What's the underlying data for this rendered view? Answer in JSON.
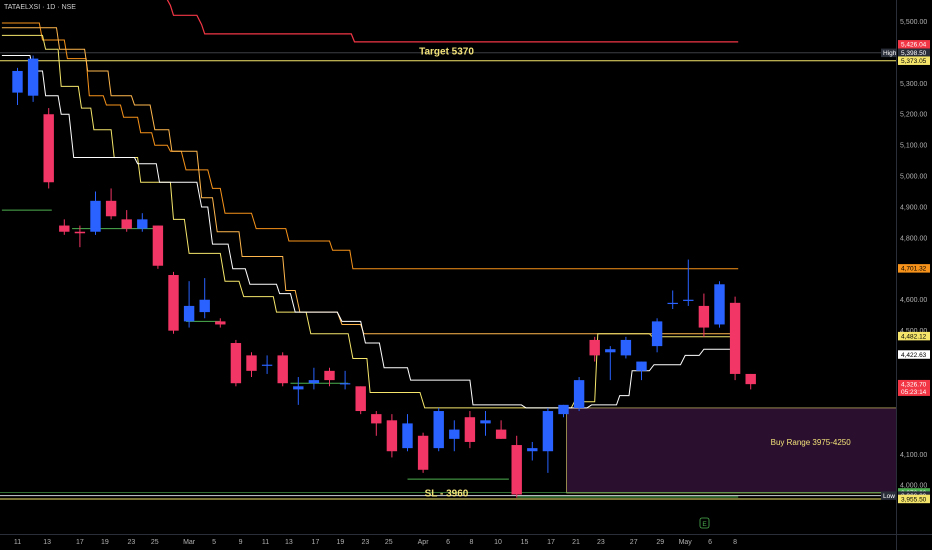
{
  "header": {
    "symbol": "TATAELXSI · 1D · NSE"
  },
  "colors": {
    "background": "#000000",
    "up_candle": "#2962ff",
    "down_candle": "#f23665",
    "line_red": "#f23645",
    "line_orange": "#f7931a",
    "line_lightorange": "#ffb74d",
    "line_yellow": "#f5e66b",
    "line_white": "#ffffff",
    "line_green": "#4caf50",
    "zone_fill": "#2a0f2e",
    "zone_border": "#f2e27a"
  },
  "chart_data": {
    "type": "candlestick",
    "y_range": [
      3880,
      5560
    ],
    "y_ticks": [
      "5,500.00",
      "5,400.00",
      "5,300.00",
      "5,200.00",
      "5,100.00",
      "5,000.00",
      "4,900.00",
      "4,800.00",
      "4,700.00",
      "4,600.00",
      "4,500.00",
      "4,100.00",
      "4,000.00"
    ],
    "y_tick_values": [
      5500,
      5400,
      5300,
      5200,
      5100,
      5000,
      4900,
      4800,
      4700,
      4600,
      4500,
      4100,
      4000
    ],
    "x_ticks": [
      "11",
      "13",
      "17",
      "19",
      "23",
      "25",
      "Mar",
      "5",
      "9",
      "11",
      "13",
      "17",
      "19",
      "23",
      "25",
      "Apr",
      "6",
      "8",
      "10",
      "15",
      "17",
      "21",
      "23",
      "27",
      "29",
      "May",
      "6",
      "8"
    ],
    "x_tick_slots": [
      0,
      1.9,
      4,
      5.6,
      7.3,
      8.8,
      11,
      12.6,
      14.3,
      15.9,
      17.4,
      19.1,
      20.7,
      22.3,
      23.8,
      26,
      27.6,
      29.1,
      30.8,
      32.5,
      34.2,
      35.8,
      37.4,
      39.5,
      41.2,
      42.8,
      44.4,
      46
    ],
    "candles": [
      {
        "o": 5270,
        "h": 5350,
        "l": 5230,
        "c": 5340
      },
      {
        "o": 5260,
        "h": 5390,
        "l": 5240,
        "c": 5380
      },
      {
        "o": 5200,
        "h": 5220,
        "l": 4960,
        "c": 4980
      },
      {
        "o": 4840,
        "h": 4860,
        "l": 4810,
        "c": 4820
      },
      {
        "o": 4820,
        "h": 4840,
        "l": 4770,
        "c": 4815
      },
      {
        "o": 4820,
        "h": 4950,
        "l": 4810,
        "c": 4920
      },
      {
        "o": 4920,
        "h": 4960,
        "l": 4860,
        "c": 4870
      },
      {
        "o": 4860,
        "h": 4890,
        "l": 4820,
        "c": 4830
      },
      {
        "o": 4830,
        "h": 4880,
        "l": 4820,
        "c": 4860
      },
      {
        "o": 4840,
        "h": 4840,
        "l": 4700,
        "c": 4710
      },
      {
        "o": 4680,
        "h": 4690,
        "l": 4490,
        "c": 4500
      },
      {
        "o": 4530,
        "h": 4660,
        "l": 4510,
        "c": 4580
      },
      {
        "o": 4560,
        "h": 4670,
        "l": 4540,
        "c": 4600
      },
      {
        "o": 4530,
        "h": 4540,
        "l": 4510,
        "c": 4520
      },
      {
        "o": 4460,
        "h": 4470,
        "l": 4320,
        "c": 4330
      },
      {
        "o": 4420,
        "h": 4430,
        "l": 4350,
        "c": 4370
      },
      {
        "o": 4390,
        "h": 4420,
        "l": 4360,
        "c": 4390
      },
      {
        "o": 4420,
        "h": 4430,
        "l": 4320,
        "c": 4330
      },
      {
        "o": 4310,
        "h": 4350,
        "l": 4260,
        "c": 4320
      },
      {
        "o": 4330,
        "h": 4380,
        "l": 4310,
        "c": 4340
      },
      {
        "o": 4370,
        "h": 4380,
        "l": 4320,
        "c": 4340
      },
      {
        "o": 4330,
        "h": 4370,
        "l": 4310,
        "c": 4330
      },
      {
        "o": 4320,
        "h": 4320,
        "l": 4230,
        "c": 4240
      },
      {
        "o": 4230,
        "h": 4240,
        "l": 4160,
        "c": 4200
      },
      {
        "o": 4210,
        "h": 4230,
        "l": 4090,
        "c": 4110
      },
      {
        "o": 4120,
        "h": 4230,
        "l": 4110,
        "c": 4200
      },
      {
        "o": 4160,
        "h": 4170,
        "l": 4040,
        "c": 4050
      },
      {
        "o": 4120,
        "h": 4250,
        "l": 4110,
        "c": 4240
      },
      {
        "o": 4150,
        "h": 4210,
        "l": 4110,
        "c": 4180
      },
      {
        "o": 4220,
        "h": 4240,
        "l": 4120,
        "c": 4140
      },
      {
        "o": 4200,
        "h": 4240,
        "l": 4160,
        "c": 4210
      },
      {
        "o": 4180,
        "h": 4210,
        "l": 4150,
        "c": 4150
      },
      {
        "o": 4130,
        "h": 4160,
        "l": 3960,
        "c": 3970
      },
      {
        "o": 4110,
        "h": 4140,
        "l": 4080,
        "c": 4120
      },
      {
        "o": 4110,
        "h": 4250,
        "l": 4040,
        "c": 4240
      },
      {
        "o": 4230,
        "h": 4260,
        "l": 4220,
        "c": 4260
      },
      {
        "o": 4250,
        "h": 4350,
        "l": 4240,
        "c": 4340
      },
      {
        "o": 4470,
        "h": 4480,
        "l": 4400,
        "c": 4420
      },
      {
        "o": 4430,
        "h": 4450,
        "l": 4340,
        "c": 4440
      },
      {
        "o": 4420,
        "h": 4480,
        "l": 4410,
        "c": 4470
      },
      {
        "o": 4370,
        "h": 4400,
        "l": 4340,
        "c": 4400
      },
      {
        "o": 4450,
        "h": 4540,
        "l": 4430,
        "c": 4530
      },
      {
        "o": 4590,
        "h": 4630,
        "l": 4570,
        "c": 4590
      },
      {
        "o": 4600,
        "h": 4730,
        "l": 4580,
        "c": 4600
      },
      {
        "o": 4580,
        "h": 4620,
        "l": 4480,
        "c": 4510
      },
      {
        "o": 4520,
        "h": 4660,
        "l": 4510,
        "c": 4650
      },
      {
        "o": 4590,
        "h": 4610,
        "l": 4340,
        "c": 4360
      },
      {
        "o": 4360,
        "h": 4360,
        "l": 4310,
        "c": 4327
      }
    ],
    "overlays": {
      "red": [
        [
          9.5,
          5580
        ],
        [
          9.8,
          5552
        ],
        [
          10,
          5520
        ],
        [
          11.5,
          5520
        ],
        [
          11.8,
          5490
        ],
        [
          12,
          5460
        ],
        [
          21.4,
          5460
        ],
        [
          21.6,
          5434
        ],
        [
          30,
          5434
        ],
        [
          46.2,
          5434
        ]
      ],
      "orange": [
        [
          -1,
          5495
        ],
        [
          1.4,
          5495
        ],
        [
          1.6,
          5440
        ],
        [
          3,
          5440
        ],
        [
          3.2,
          5380
        ],
        [
          4.4,
          5380
        ],
        [
          4.6,
          5260
        ],
        [
          5.5,
          5260
        ],
        [
          5.7,
          5230
        ],
        [
          6.6,
          5230
        ],
        [
          6.8,
          5190
        ],
        [
          7.7,
          5190
        ],
        [
          7.9,
          5140
        ],
        [
          8.6,
          5140
        ],
        [
          8.8,
          5100
        ],
        [
          9.6,
          5100
        ],
        [
          9.8,
          5080
        ],
        [
          10.5,
          5080
        ],
        [
          10.8,
          5020
        ],
        [
          12.2,
          5020
        ],
        [
          12.5,
          4960
        ],
        [
          13,
          4960
        ],
        [
          13.3,
          4880
        ],
        [
          15,
          4880
        ],
        [
          15.3,
          4830
        ],
        [
          17.2,
          4830
        ],
        [
          17.4,
          4790
        ],
        [
          20,
          4790
        ],
        [
          20.2,
          4760
        ],
        [
          21.3,
          4760
        ],
        [
          21.5,
          4700
        ],
        [
          46.2,
          4700
        ]
      ],
      "lightorange": [
        [
          -1,
          5480
        ],
        [
          2.5,
          5480
        ],
        [
          2.7,
          5410
        ],
        [
          4.3,
          5410
        ],
        [
          4.5,
          5340
        ],
        [
          5.8,
          5340
        ],
        [
          6,
          5260
        ],
        [
          7.3,
          5260
        ],
        [
          7.5,
          5230
        ],
        [
          8.5,
          5230
        ],
        [
          8.8,
          5150
        ],
        [
          9.7,
          5150
        ],
        [
          9.9,
          5080
        ],
        [
          11.5,
          5080
        ],
        [
          11.8,
          4930
        ],
        [
          12.5,
          4930
        ],
        [
          12.8,
          4820
        ],
        [
          14.2,
          4820
        ],
        [
          14.4,
          4740
        ],
        [
          17,
          4740
        ],
        [
          17.2,
          4630
        ],
        [
          17.8,
          4630
        ],
        [
          18.1,
          4560
        ],
        [
          20.5,
          4560
        ],
        [
          20.8,
          4520
        ],
        [
          22,
          4520
        ],
        [
          22.2,
          4490
        ],
        [
          46.2,
          4490
        ]
      ],
      "yellow": [
        [
          -1,
          5455
        ],
        [
          1.6,
          5455
        ],
        [
          1.8,
          5410
        ],
        [
          2.6,
          5410
        ],
        [
          2.8,
          5290
        ],
        [
          3.9,
          5290
        ],
        [
          4.1,
          5220
        ],
        [
          4.7,
          5220
        ],
        [
          4.9,
          5150
        ],
        [
          6,
          5150
        ],
        [
          6.2,
          5060
        ],
        [
          7.7,
          5060
        ],
        [
          7.9,
          4980
        ],
        [
          9.8,
          4980
        ],
        [
          10,
          4860
        ],
        [
          10.7,
          4860
        ],
        [
          11,
          4750
        ],
        [
          13,
          4750
        ],
        [
          13.3,
          4660
        ],
        [
          14.2,
          4660
        ],
        [
          14.5,
          4610
        ],
        [
          16.4,
          4610
        ],
        [
          16.6,
          4560
        ],
        [
          18.5,
          4560
        ],
        [
          18.8,
          4490
        ],
        [
          21.2,
          4490
        ],
        [
          21.5,
          4410
        ],
        [
          22.4,
          4410
        ],
        [
          22.6,
          4300
        ],
        [
          25.8,
          4300
        ],
        [
          26.1,
          4250
        ],
        [
          35.5,
          4250
        ],
        [
          35.7,
          4270
        ],
        [
          37,
          4270
        ],
        [
          37.2,
          4490
        ],
        [
          40.5,
          4490
        ],
        [
          40.7,
          4480
        ],
        [
          46.2,
          4480
        ]
      ],
      "white": [
        [
          -1,
          5390
        ],
        [
          0.8,
          5390
        ],
        [
          1,
          5340
        ],
        [
          1.6,
          5340
        ],
        [
          1.8,
          5260
        ],
        [
          2.6,
          5260
        ],
        [
          2.8,
          5200
        ],
        [
          3.3,
          5200
        ],
        [
          3.6,
          5060
        ],
        [
          7.5,
          5060
        ],
        [
          7.7,
          5040
        ],
        [
          8.9,
          5040
        ],
        [
          9.1,
          4980
        ],
        [
          11.5,
          4980
        ],
        [
          11.8,
          4900
        ],
        [
          12.2,
          4900
        ],
        [
          12.5,
          4780
        ],
        [
          13.5,
          4780
        ],
        [
          13.8,
          4700
        ],
        [
          14.6,
          4700
        ],
        [
          14.9,
          4650
        ],
        [
          16.6,
          4650
        ],
        [
          16.8,
          4620
        ],
        [
          17.5,
          4620
        ],
        [
          17.8,
          4560
        ],
        [
          20.5,
          4560
        ],
        [
          20.8,
          4530
        ],
        [
          22,
          4530
        ],
        [
          22.3,
          4460
        ],
        [
          23.2,
          4460
        ],
        [
          23.5,
          4380
        ],
        [
          25,
          4380
        ],
        [
          25.2,
          4340
        ],
        [
          29,
          4340
        ],
        [
          29.2,
          4260
        ],
        [
          32.3,
          4260
        ],
        [
          32.6,
          4250
        ],
        [
          36.5,
          4250
        ],
        [
          36.8,
          4260
        ],
        [
          38.4,
          4260
        ],
        [
          38.6,
          4290
        ],
        [
          39.2,
          4290
        ],
        [
          39.4,
          4370
        ],
        [
          40.5,
          4370
        ],
        [
          40.8,
          4390
        ],
        [
          42.5,
          4390
        ],
        [
          42.8,
          4420
        ],
        [
          43.7,
          4420
        ],
        [
          44,
          4440
        ],
        [
          46.2,
          4440
        ]
      ],
      "green": [
        [
          -1,
          4890
        ],
        [
          2.2,
          4890
        ],
        null,
        [
          3.5,
          4830
        ],
        [
          9.3,
          4830
        ],
        null,
        [
          10.8,
          4530
        ],
        [
          13,
          4530
        ],
        null,
        [
          17.5,
          4330
        ],
        [
          21.2,
          4330
        ],
        null,
        [
          25,
          4020
        ],
        [
          31.5,
          4020
        ],
        null,
        [
          32,
          3962
        ],
        [
          46.2,
          3962
        ]
      ]
    },
    "buy_zone": {
      "x0": 35.2,
      "x1": 57,
      "top": 4250,
      "bottom": 3975,
      "label": "Buy Range 3975-4250"
    },
    "annotations": [
      {
        "text": "Target 5370",
        "slot": 27.5,
        "price": 5405
      },
      {
        "text": "SL - 3960",
        "slot": 27.5,
        "price": 3975
      }
    ],
    "h_lines": [
      {
        "price": 5398.5,
        "color": "#787b86",
        "width": 0.6
      },
      {
        "price": 5373.05,
        "color": "#f5e66b",
        "width": 1
      },
      {
        "price": 3976.6,
        "color": "#4caf50",
        "width": 0.6
      },
      {
        "price": 3966.2,
        "color": "#d1d4dc",
        "width": 1
      },
      {
        "price": 3955.5,
        "color": "#f5e66b",
        "width": 1
      }
    ],
    "price_tags": [
      {
        "text": "5,426.04",
        "price": 5426.04,
        "bg": "#f23645",
        "fg": "#ffffff"
      },
      {
        "text": "5,398.50",
        "price": 5398.5,
        "bg": "#2a2e39",
        "fg": "#ffffff",
        "side_label": "High"
      },
      {
        "text": "5,373.05",
        "price": 5373.05,
        "bg": "#f5e66b",
        "fg": "#000000"
      },
      {
        "text": "4,701.32",
        "price": 4701.32,
        "bg": "#f7931a",
        "fg": "#000000"
      },
      {
        "text": "4,482.12",
        "price": 4482.12,
        "bg": "#f5e66b",
        "fg": "#000000"
      },
      {
        "text": "4,422.63",
        "price": 4422.63,
        "bg": "#ffffff",
        "fg": "#000000"
      },
      {
        "text": "4,326.70",
        "price": 4326.7,
        "bg": "#f23645",
        "fg": "#ffffff",
        "sub": "05:23:14"
      },
      {
        "text": "3,976.60",
        "price": 3976.6,
        "bg": "#4caf50",
        "fg": "#ffffff"
      },
      {
        "text": "3,966.20",
        "price": 3966.2,
        "bg": "#2a2e39",
        "fg": "#ffffff",
        "side_label": "Low"
      },
      {
        "text": "3,955.50",
        "price": 3955.5,
        "bg": "#f5e66b",
        "fg": "#000000"
      }
    ]
  }
}
